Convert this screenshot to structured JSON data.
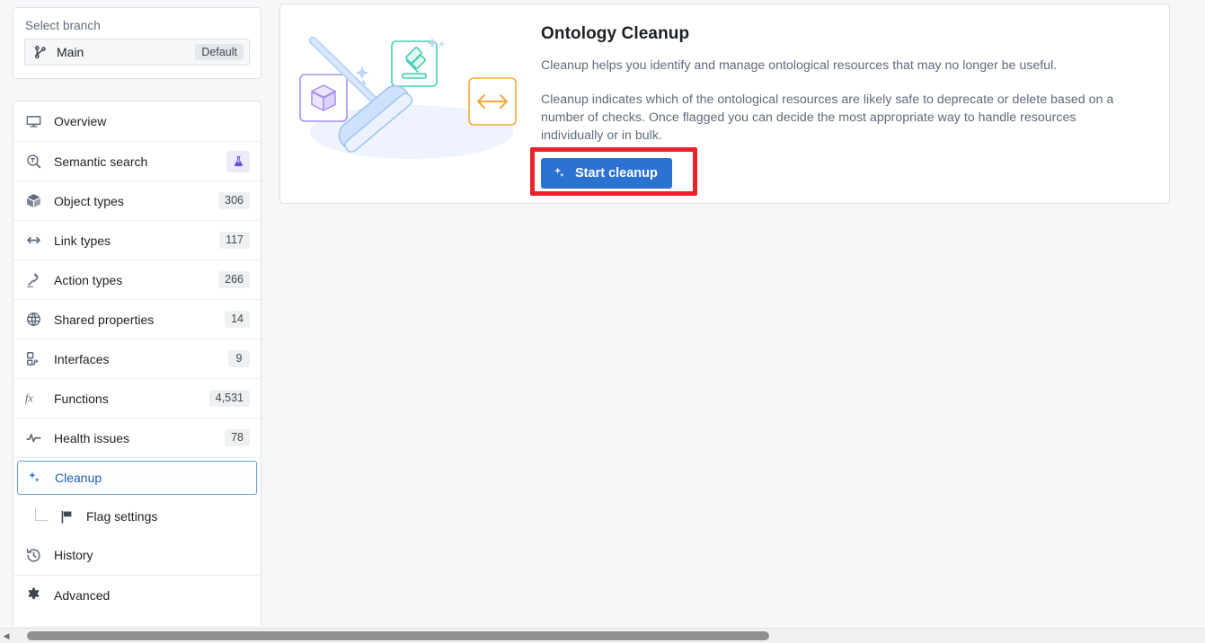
{
  "sidebar": {
    "branch": {
      "label": "Select branch",
      "icon": "git-branch-icon",
      "name": "Main",
      "tag": "Default"
    },
    "items": [
      {
        "id": "overview",
        "label": "Overview",
        "icon": "desktop-icon",
        "count": "",
        "badge": ""
      },
      {
        "id": "semantic-search",
        "label": "Semantic search",
        "icon": "search-text-icon",
        "count": "",
        "badge": "flask-icon"
      },
      {
        "id": "object-types",
        "label": "Object types",
        "icon": "cube-icon",
        "count": "306",
        "badge": ""
      },
      {
        "id": "link-types",
        "label": "Link types",
        "icon": "arrows-horizontal-icon",
        "count": "117",
        "badge": ""
      },
      {
        "id": "action-types",
        "label": "Action types",
        "icon": "gavel-icon",
        "count": "266",
        "badge": ""
      },
      {
        "id": "shared-properties",
        "label": "Shared properties",
        "icon": "globe-network-icon",
        "count": "14",
        "badge": ""
      },
      {
        "id": "interfaces",
        "label": "Interfaces",
        "icon": "interface-icon",
        "count": "9",
        "badge": ""
      },
      {
        "id": "functions",
        "label": "Functions",
        "icon": "fx-icon",
        "count": "4,531",
        "badge": ""
      },
      {
        "id": "health-issues",
        "label": "Health issues",
        "icon": "pulse-icon",
        "count": "78",
        "badge": ""
      }
    ],
    "cleanup": {
      "label": "Cleanup",
      "icon": "sparkle-icon"
    },
    "flag_settings": {
      "label": "Flag settings",
      "icon": "flag-icon"
    },
    "bottom_items": [
      {
        "id": "history",
        "label": "History",
        "icon": "history-icon"
      },
      {
        "id": "advanced",
        "label": "Advanced",
        "icon": "gear-icon"
      }
    ]
  },
  "main": {
    "card": {
      "title": "Ontology Cleanup",
      "paragraph1": "Cleanup helps you identify and manage ontological resources that may no longer be useful.",
      "paragraph2": "Cleanup indicates which of the ontological resources are likely safe to deprecate or delete based on a number of checks. Once flagged you can decide the most appropriate way to handle resources individually or in bulk.",
      "button": {
        "label": "Start cleanup",
        "icon": "sparkle-icon"
      }
    }
  },
  "colors": {
    "accent_blue": "#2d72d2",
    "selected_border": "#6c9ce6",
    "highlight_red": "#e8232a",
    "page_background": "#f6f7f9",
    "panel_background": "#ffffff",
    "muted_text": "#5f6b7c",
    "illustration_purple": "#a082e8",
    "illustration_teal": "#3fc8ad",
    "illustration_orange": "#f2a33c",
    "illustration_blue": "#9dc3f7"
  }
}
